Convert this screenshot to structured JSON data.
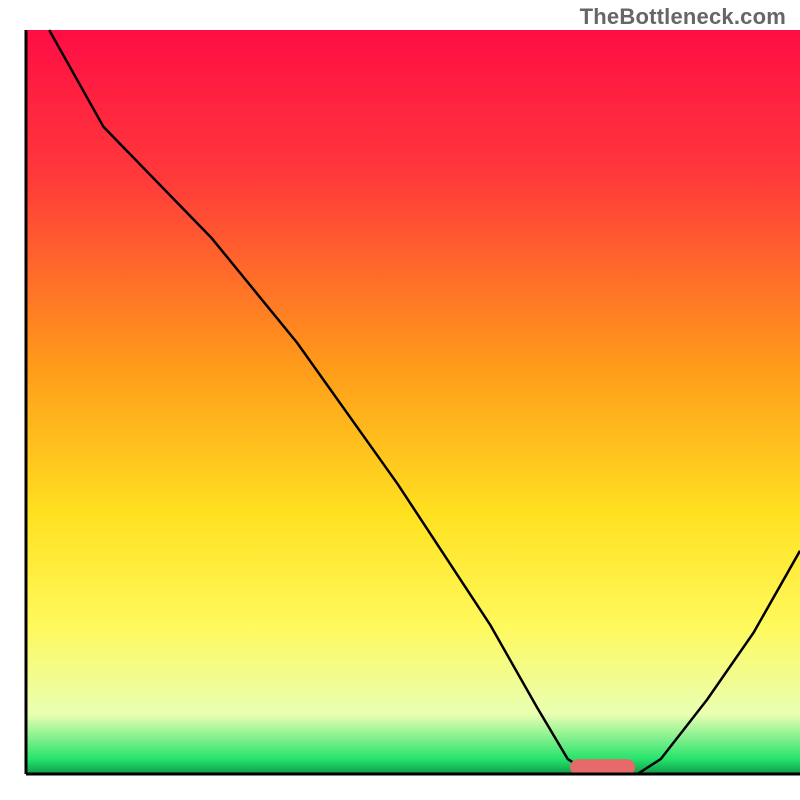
{
  "watermark": "TheBottleneck.com",
  "chart_data": {
    "type": "line",
    "title": "",
    "xlabel": "",
    "ylabel": "",
    "xlim": [
      0,
      100
    ],
    "ylim": [
      0,
      100
    ],
    "gradient_stops": [
      {
        "offset": 0,
        "color": "#ff0d45"
      },
      {
        "offset": 20,
        "color": "#ff3a3a"
      },
      {
        "offset": 45,
        "color": "#ff9a1a"
      },
      {
        "offset": 65,
        "color": "#ffe120"
      },
      {
        "offset": 80,
        "color": "#fff95c"
      },
      {
        "offset": 92,
        "color": "#e9ffb3"
      },
      {
        "offset": 98,
        "color": "#26e36b"
      },
      {
        "offset": 100,
        "color": "#109b4c"
      }
    ],
    "series": [
      {
        "name": "bottleneck-curve",
        "color": "#000000",
        "stroke_width": 2.5,
        "x": [
          3,
          10,
          24,
          35,
          48,
          60,
          66,
          70,
          73,
          76,
          79,
          82,
          88,
          94,
          100
        ],
        "values": [
          100,
          87,
          72,
          58,
          39,
          20,
          9,
          2,
          0,
          0,
          0,
          2,
          10,
          19,
          30
        ]
      }
    ],
    "marker": {
      "x_center": 74.5,
      "x_halfwidth": 4.2,
      "y": 0.9,
      "thickness": 2.2,
      "color": "#e76a6a"
    },
    "axes_color": "#000000",
    "axes_width": 3
  }
}
